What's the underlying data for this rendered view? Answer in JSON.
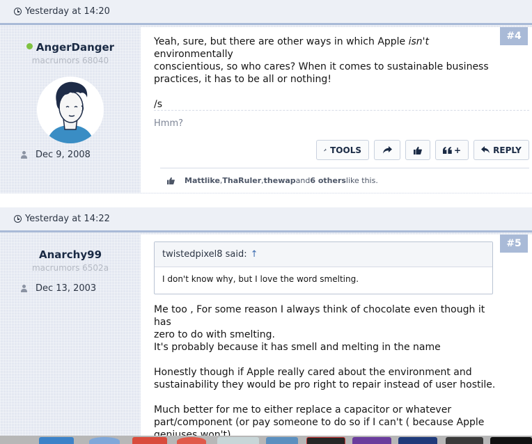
{
  "posts": [
    {
      "timestamp": "Yesterday at 14:20",
      "number": "#4",
      "username": "AngerDanger",
      "user_title": "macrumors 68040",
      "online": true,
      "joined": "Dec 9, 2008",
      "message": {
        "line1_before": "Yeah, sure, but there are other ways in which Apple ",
        "line1_em": "isn't",
        "line1_after": " environmentally",
        "line2": "conscientious, so who cares? When it comes to sustainable business",
        "line3": "practices, it has to be all or nothing!",
        "line4": "/s"
      },
      "signature": "Hmm?",
      "buttons": {
        "tools": "TOOLS",
        "reply": "REPLY"
      },
      "likes": {
        "user1": "Mattlike",
        "user2": "ThaRuler",
        "user3": "thewap",
        "sep1": ", ",
        "sep2": ", ",
        "conj": " and ",
        "others": "6 others",
        "suffix": " like this."
      }
    },
    {
      "timestamp": "Yesterday at 14:22",
      "number": "#5",
      "username": "Anarchy99",
      "user_title": "macrumors 6502a",
      "joined": "Dec 13, 2003",
      "quote": {
        "author": "twistedpixel8 said:",
        "arrow": "↑",
        "text": "I don't know why, but I love the word smelting."
      },
      "message": {
        "p1_l1": "Me too , For some reason I always think of chocolate even though it has",
        "p1_l2": "zero to do with smelting.",
        "p1_l3": "It's probably because it has smell and melting in the name",
        "p2_l1": "Honestly though if Apple really cared about the environment and",
        "p2_l2": "sustainability they would be pro right to repair instead of user hostile.",
        "p3_l1": "Much better for me to either replace a capacitor or whatever",
        "p3_l2": "part/component (or pay someone to do so if I can't ( because Apple",
        "p3_l3": "geniuses won't)"
      }
    }
  ],
  "icons": {
    "clock": "clock-icon",
    "person": "person-icon",
    "wrench": "wrench-icon",
    "share": "share-icon",
    "like": "thumbs-up-icon",
    "quote": "quote-icon",
    "reply": "reply-icon"
  },
  "colors": {
    "accent": "#a9bad7",
    "online": "#7fc241",
    "username": "#1a2a44",
    "link": "#3c6cb0"
  }
}
